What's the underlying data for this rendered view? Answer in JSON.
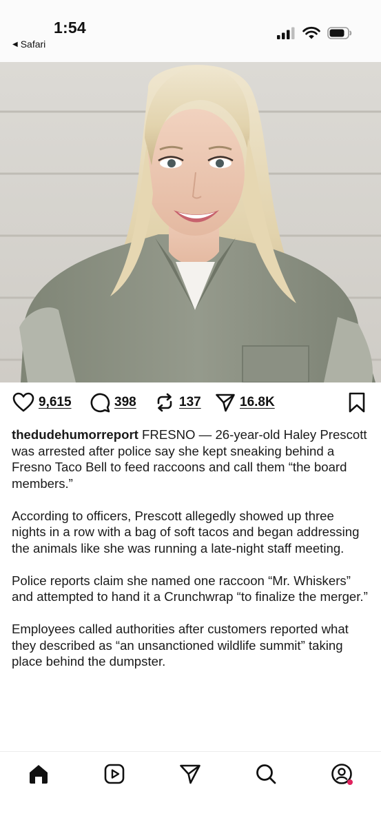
{
  "status_bar": {
    "time": "1:54",
    "back_app": "Safari",
    "icons": [
      "cellular-signal-icon",
      "wifi-icon",
      "battery-icon"
    ]
  },
  "post": {
    "image_alt": "photo",
    "likes": "9,615",
    "comments": "398",
    "reposts": "137",
    "shares": "16.8K",
    "username": "thedudehumorreport",
    "caption_lead": " FRESNO — 26-year-old Haley Prescott was arrested after police say she kept sneaking behind a Fresno Taco Bell to feed raccoons and call them “the board members.”",
    "paragraphs": [
      "According to officers, Prescott allegedly showed up three nights in a row with a bag of soft tacos and began addressing the animals like she was running a late-night staff meeting.",
      "Police reports claim she named one raccoon “Mr. Whiskers” and attempted to hand it a Crunchwrap “to finalize the merger.”",
      "Employees called authorities after customers reported what they described as “an unsanctioned wildlife summit” taking place behind the dumpster."
    ]
  },
  "bottom_nav": {
    "items": [
      "home-icon",
      "reels-icon",
      "send-icon",
      "search-icon",
      "profile-icon"
    ],
    "notification_color": "#e0245e"
  },
  "colors": {
    "text": "#111111",
    "photo_wall": "#d8d6d1",
    "uniform": "#8a8f82"
  }
}
